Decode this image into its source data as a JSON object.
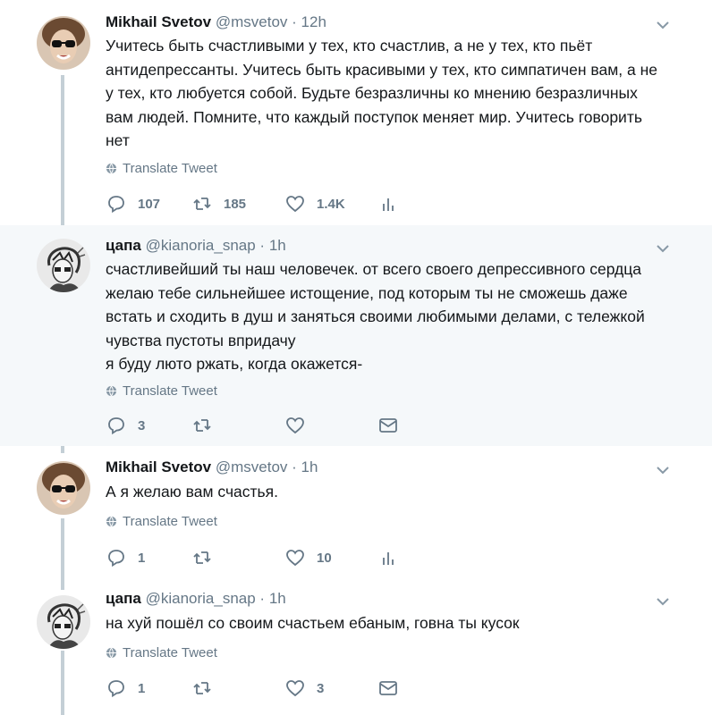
{
  "common": {
    "translate_label": "Translate Tweet",
    "dot": "·"
  },
  "tweets": [
    {
      "name": "Mikhail Svetov",
      "handle": "@msvetov",
      "time": "12h",
      "text": "Учитесь быть счастливыми у тех, кто счастлив, а не у тех, кто пьёт\nантидепрессанты. Учитесь быть красивыми у тех, кто симпатичен вам, а не\nу тех, кто любуется собой. Будьте безразличны ко мнению безразличных\nвам людей. Помните, что каждый поступок меняет мир. Учитесь говорить\nнет",
      "replies": "107",
      "retweets": "185",
      "likes": "1.4K"
    },
    {
      "name": "цапа",
      "handle": "@kianoria_snap",
      "time": "1h",
      "text": "счастливейший ты наш человечек. от всего своего депрессивного сердца\nжелаю тебе сильнейшее истощение, под которым ты не сможешь даже\nвстать и сходить в душ и заняться своими любимыми делами, с тележкой\nчувства пустоты впридачу\nя буду люто ржать, когда окажется-",
      "replies": "3",
      "retweets": "",
      "likes": ""
    },
    {
      "name": "Mikhail Svetov",
      "handle": "@msvetov",
      "time": "1h",
      "text": "А я желаю вам счастья.",
      "replies": "1",
      "retweets": "",
      "likes": "10"
    },
    {
      "name": "цапа",
      "handle": "@kianoria_snap",
      "time": "1h",
      "text": "на хуй пошёл со своим счастьем ебаным, говна ты кусок",
      "replies": "1",
      "retweets": "",
      "likes": "3"
    }
  ],
  "colors": {
    "text": "#14171a",
    "muted": "#657786",
    "thread_line": "#c4cfd6",
    "highlight_bg": "#f5f8fa"
  },
  "icons": [
    "reply-icon",
    "retweet-icon",
    "like-icon",
    "analytics-icon",
    "dm-icon",
    "globe-icon",
    "caret-down-icon"
  ]
}
